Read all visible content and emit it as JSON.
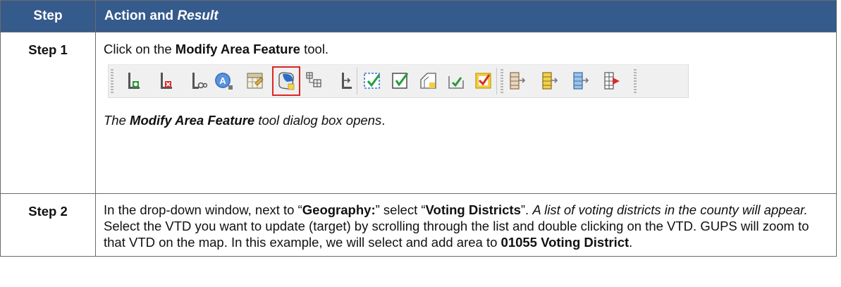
{
  "header": {
    "step_label": "Step",
    "action_label": "Action and ",
    "result_label": "Result"
  },
  "rows": [
    {
      "step": "Step 1",
      "instruction_pre": "Click on the ",
      "instruction_bold": "Modify Area Feature",
      "instruction_post": " tool.",
      "result_pre": "The ",
      "result_bold": "Modify Area Feature",
      "result_post": " tool dialog box opens",
      "result_end": "."
    },
    {
      "step": "Step 2",
      "t1": "In the drop-down window, next to “",
      "t2": "Geography:",
      "t3": "” select “",
      "t4": "Voting Districts",
      "t5": "”. ",
      "t6": "A list of voting districts in the county will appear.",
      "t7": " Select the VTD you want to update (target) by scrolling through the list and double clicking on the VTD. GUPS will zoom to that VTD on the map. In this example, we will select and add area to ",
      "t8": "01055 Voting District",
      "t9": "."
    }
  ],
  "toolbar": {
    "icons": [
      "add-line-icon",
      "delete-line-icon",
      "split-line-icon",
      "label-icon",
      "attribute-table-icon",
      "modify-area-feature-icon",
      "merge-icon",
      "anchor-icon",
      "review-icon",
      "review-check-icon",
      "shape-check-icon",
      "area-check-icon",
      "flag-check-icon",
      "export-icon",
      "export-yellow-icon",
      "export-blue-icon",
      "export-red-icon"
    ],
    "selected": "modify-area-feature-icon"
  }
}
